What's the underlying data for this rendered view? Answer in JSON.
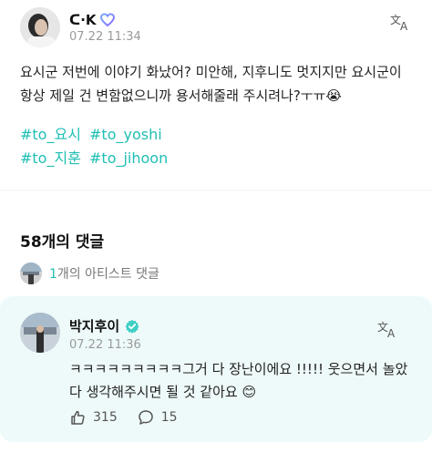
{
  "post": {
    "author_name": "ᑕ·K",
    "timestamp": "07.22 11:34",
    "body": "요시군  저번에 이야기 화났어? 미안해, 지후니도 멋지지만 요시군이 항상 제일 건 변함없으니까 용서해줄래 주시려나?ㅜㅠ😭",
    "hashtags": [
      "#to_요시",
      "#to_yoshi",
      "#to_지훈",
      "#to_jihoon"
    ]
  },
  "comments_section": {
    "count_label": "58개의 댓글",
    "artist_comments_count": "1",
    "artist_comments_label": "개의 아티스트 댓글"
  },
  "comment": {
    "author_name": "박지후이",
    "timestamp": "07.22 11:36",
    "text": "ㅋㅋㅋㅋㅋㅋㅋㅋㅋ그거 다 장난이에요 !!!!! 웃으면서 놀았다 생각해주시면 될 것 같아요 😊",
    "likes": "315",
    "replies": "15"
  },
  "colors": {
    "accent": "#1fbfb3",
    "comment_bg": "#eef9f9",
    "verified": "#3ecfc4"
  },
  "icons": {
    "translate": "translate-icon",
    "verified": "verified-badge-icon",
    "fan_badge": "heart-badge-icon",
    "like": "like-icon",
    "reply": "reply-icon"
  }
}
